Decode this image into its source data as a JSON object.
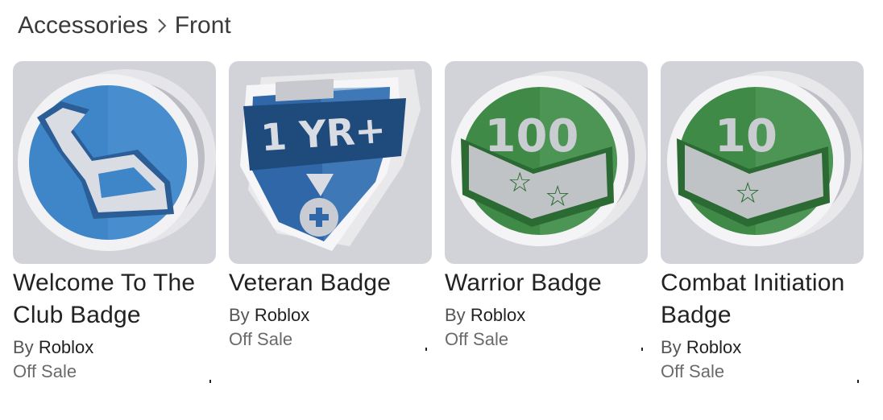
{
  "breadcrumb": {
    "items": [
      "Accessories",
      "Front"
    ],
    "separator_icon": "chevron-right-icon"
  },
  "items": [
    {
      "title": "Welcome To The Club Badge",
      "by_label": "By",
      "creator": "Roblox",
      "price": "Off Sale",
      "badge_colors": {
        "primary": "#3f86c8",
        "dark": "#2a5f96"
      }
    },
    {
      "title": "Veteran Badge",
      "by_label": "By",
      "creator": "Roblox",
      "price": "Off Sale",
      "badge_text": "1 YR+",
      "badge_colors": {
        "primary": "#2f67a8",
        "dark": "#1f4a7c"
      }
    },
    {
      "title": "Warrior Badge",
      "by_label": "By",
      "creator": "Roblox",
      "price": "Off Sale",
      "badge_text": "100",
      "badge_colors": {
        "primary": "#3f8a47",
        "dark": "#2c6a33"
      }
    },
    {
      "title": "Combat Initiation Badge",
      "by_label": "By",
      "creator": "Roblox",
      "price": "Off Sale",
      "badge_text": "10",
      "badge_colors": {
        "primary": "#3f8a47",
        "dark": "#2c6a33"
      }
    }
  ],
  "colors": {
    "thumb_background": "#d2d3d9",
    "text_primary": "#222222",
    "text_secondary": "#6a6a6a"
  }
}
